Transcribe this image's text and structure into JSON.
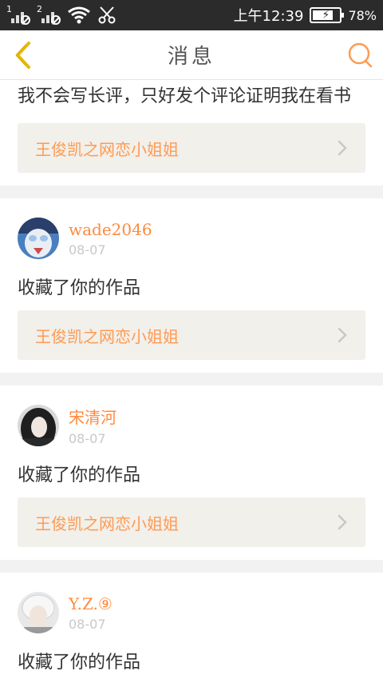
{
  "status_bar": {
    "sim1": "1",
    "sim2": "2",
    "time": "上午12:39",
    "battery": "78%",
    "battery_level": 0.78,
    "icons": [
      "signal-1-icon",
      "signal-2-icon",
      "wifi-icon",
      "scissors-icon",
      "battery-icon"
    ]
  },
  "header": {
    "title": "消息",
    "back_icon": "chevron-left-icon",
    "search_icon": "search-icon"
  },
  "messages": [
    {
      "text": "我不会写长评，只好发个评论证明我在看书",
      "book": "王俊凯之网恋小姐姐"
    },
    {
      "username": "wade2046",
      "date": "08-07",
      "text": "收藏了你的作品",
      "book": "王俊凯之网恋小姐姐"
    },
    {
      "username": "宋清河",
      "date": "08-07",
      "text": "收藏了你的作品",
      "book": "王俊凯之网恋小姐姐"
    },
    {
      "username": "Y.Z.⑨",
      "date": "08-07",
      "text": "收藏了你的作品"
    }
  ],
  "colors": {
    "accent": "#ff8a3d",
    "back_icon": "#e8b800",
    "search_icon": "#ff9a52",
    "book_bg": "#f1f0eb"
  }
}
